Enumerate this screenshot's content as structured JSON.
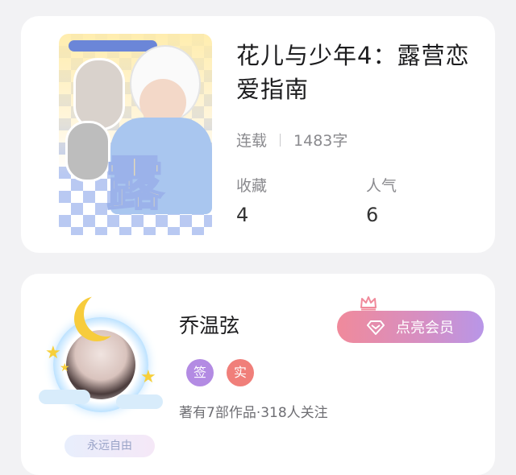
{
  "book": {
    "title": "花儿与少年4：露营恋爱指南",
    "status": "连载",
    "word_count": "1483字",
    "stats": [
      {
        "label": "收藏",
        "value": "4"
      },
      {
        "label": "人气",
        "value": "6"
      }
    ]
  },
  "author": {
    "name": "乔温弦",
    "badge": "永远自由",
    "vip_button_label": "点亮会员",
    "tags": [
      {
        "label": "签",
        "color": "#b38be3"
      },
      {
        "label": "实",
        "color": "#f07f7a"
      }
    ],
    "works_summary": "著有7部作品·318人关注"
  },
  "icons": [
    "diamond-icon",
    "crown-icon",
    "moon-icon",
    "star-icon"
  ]
}
